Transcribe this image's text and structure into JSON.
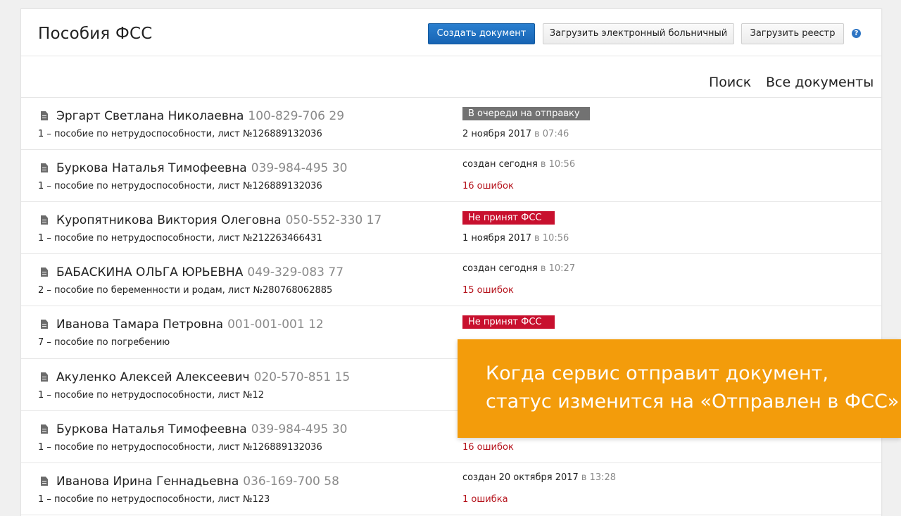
{
  "header": {
    "title": "Пособия ФСС",
    "create_label": "Создать документ",
    "upload_sick_label": "Загрузить электронный больничный",
    "upload_registry_label": "Загрузить реестр",
    "help_glyph": "?"
  },
  "subnav": {
    "search_label": "Поиск",
    "all_docs_label": "Все документы"
  },
  "rows": [
    {
      "name": "Эргарт Светлана Николаевна",
      "snils": "100-829-706 29",
      "benefit": "1 – пособие по нетрудоспособности, лист №126889132036",
      "status": "В очереди на отправку",
      "date": "2 ноября 2017",
      "time": "в 07:46"
    },
    {
      "name": "Буркова Наталья Тимофеевна",
      "snils": "039-984-495 30",
      "benefit": "1 – пособие по нетрудоспособности, лист №126889132036",
      "created": "создан сегодня",
      "created_time": "в 10:56",
      "errors": "16 ошибок"
    },
    {
      "name": "Куропятникова Виктория Олеговна",
      "snils": "050-552-330 17",
      "benefit": "1 – пособие по нетрудоспособности, лист №212263466431",
      "status": "Не принят ФСС",
      "date": "1 ноября 2017",
      "time": "в 10:56"
    },
    {
      "name": "БАБАСКИНА ОЛЬГА ЮРЬЕВНА",
      "snils": "049-329-083 77",
      "benefit": "2 – пособие по беременности и родам, лист №280768062885",
      "created": "создан сегодня",
      "created_time": "в 10:27",
      "errors": "15 ошибок"
    },
    {
      "name": "Иванова Тамара Петровна",
      "snils": "001-001-001 12",
      "benefit": "7 – пособие по погребению",
      "status": "Не принят ФСС"
    },
    {
      "name": "Акуленко Алексей Алексеевич",
      "snils": "020-570-851 15",
      "benefit": "1 – пособие по нетрудоспособности, лист №12"
    },
    {
      "name": "Буркова Наталья Тимофеевна",
      "snils": "039-984-495 30",
      "benefit": "1 – пособие по нетрудоспособности, лист №126889132036",
      "errors": "16 ошибок"
    },
    {
      "name": "Иванова Ирина Геннадьевна",
      "snils": "036-169-700 58",
      "benefit": "1 – пособие по нетрудоспособности, лист №123",
      "created": "создан 20 октября 2017",
      "created_time": "в 13:28",
      "errors": "1 ошибка"
    }
  ],
  "callout": {
    "line1": "Когда сервис отправит документ,",
    "line2": "статус изменится на «Отправлен в ФСС»"
  },
  "colors": {
    "primary": "#1764b4",
    "status_gray": "#727272",
    "status_red": "#c8102e",
    "error_text": "#b5121b",
    "callout_bg": "#f39c0b"
  }
}
